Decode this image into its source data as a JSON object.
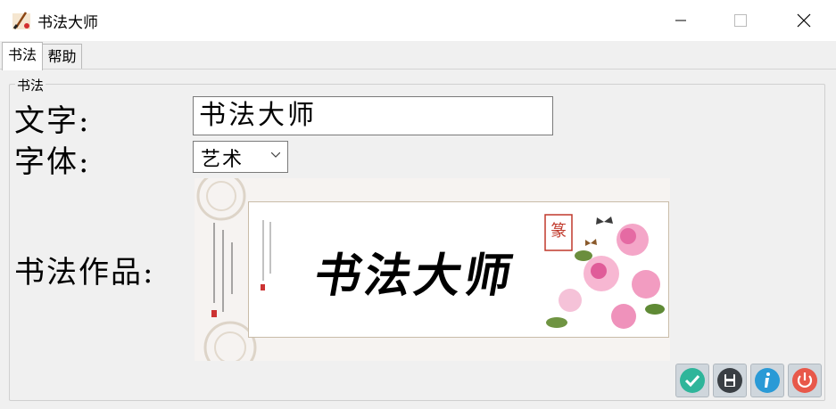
{
  "window": {
    "title": "书法大师",
    "icon": "calligraphy-app-icon"
  },
  "tabs": [
    {
      "label": "书法",
      "active": true
    },
    {
      "label": "帮助",
      "active": false
    }
  ],
  "group": {
    "title": "书法"
  },
  "form": {
    "text_label": "文字:",
    "text_value": "书法大师",
    "font_label": "字体:",
    "font_value": "艺术",
    "artwork_label": "书法作品:"
  },
  "artwork": {
    "calligraphy_text": "书法大师",
    "description": "calligraphy scroll with peony flowers and butterflies"
  },
  "toolbar": {
    "buttons": [
      {
        "name": "confirm-button",
        "icon": "check-icon",
        "color": "#2fb59a"
      },
      {
        "name": "save-button",
        "icon": "floppy-disk-icon",
        "color": "#3a3f44"
      },
      {
        "name": "info-button",
        "icon": "info-icon",
        "color": "#2a9ad6"
      },
      {
        "name": "power-button",
        "icon": "power-icon",
        "color": "#e8584a"
      }
    ]
  }
}
